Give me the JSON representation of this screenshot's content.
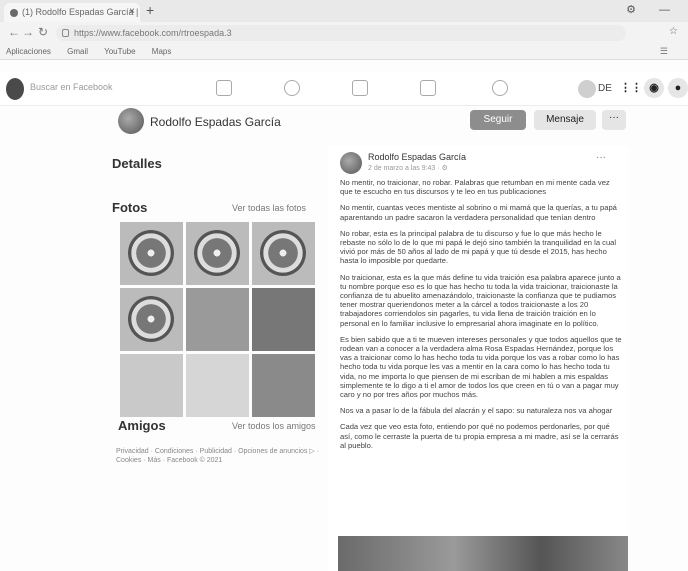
{
  "browser": {
    "tab_title": "(1) Rodolfo Espadas García | Faceb",
    "tab_close": "×",
    "new_tab": "+",
    "window_controls": "⚙ —",
    "url": "https://www.facebook.com/rtroespada.3",
    "addr_right": "☆",
    "bookmarks": [
      "Aplicaciones",
      "Gmail",
      "YouTube",
      "Maps"
    ],
    "bookmarks_right": "☰"
  },
  "fb_nav": {
    "search_placeholder": "Buscar en Facebook",
    "user_short": "DE",
    "grid_icon": "⋮⋮⋮",
    "messenger_icon": "◉",
    "bell_icon": "●"
  },
  "profile": {
    "name": "Rodolfo Espadas García",
    "follow_label": "Seguir",
    "message_label": "Mensaje",
    "more_label": "···"
  },
  "left": {
    "details_title": "Detalles",
    "photos_title": "Fotos",
    "see_all_photos": "Ver todas las fotos",
    "friends_title": "Amigos",
    "see_all_friends": "Ver todos los amigos",
    "footer": "Privacidad · Condiciones · Publicidad · Opciones de anuncios ▷ · Cookies · Más · Facebook © 2021"
  },
  "post": {
    "author": "Rodolfo Espadas García",
    "meta": "2 de marzo a las 9:43 · ⚙",
    "more": "···",
    "paragraphs": [
      "No mentir, no traicionar, no robar. Palabras que retumban en mi mente cada vez que te escucho en tus discursos y te leo en tus publicaciones",
      "No mentir, cuantas veces mentiste al sobrino o mi mamá que la querías, a tu papá aparentando un padre sacaron la verdadera personalidad que tenían dentro",
      "No robar, esta es la principal palabra de tu discurso y fue lo que más hecho le rebaste no sólo lo de lo que mi papá le dejó sino también la tranquilidad en la cual vivió por más de 50 años al lado de mi papá y que tú desde el 2015, has hecho hasta lo imposible por quedarte.",
      "No traicionar, esta es la que más define tu vida traición esa palabra aparece junto a tu nombre porque eso es lo que has hecho tu toda la vida traicionar, traicionaste la confianza de tu abuelito amenazándolo, traicionaste la confianza que te pudiamos tener mostrar queriendonos meter a la cárcel a todos traicionaste a los 20 trabajadores corriendolos sin pagarles, tu vida llena de traición traición en lo personal en lo familiar inclusive lo empresarial ahora imaginate en lo político.",
      "Es bien sabido que a ti te mueven intereses personales y que todos aquellos que te rodean van a conocer a la verdadera alma Rosa Espadas Hernández, porque los vas a traicionar como lo has hecho toda tu vida porque los vas a robar como lo has hecho toda tu vida porque les vas a mentir en la cara como lo has hecho toda tu vida, no me importa lo que piensen de mi escriban de mi hablen a mis espaldas simplemente te lo digo a ti el amor de todos los que creen en tú o van a pagar muy caro y no por tres años por muchos más.",
      "Nos va a pasar lo de la fábula del alacrán y el sapo: su naturaleza nos va ahogar",
      "Cada vez que veo esta foto, entiendo por qué no podemos perdonarles, por qué así, como le cerraste la puerta de tu propia empresa a mi madre, así se la cerrarás al pueblo."
    ]
  }
}
